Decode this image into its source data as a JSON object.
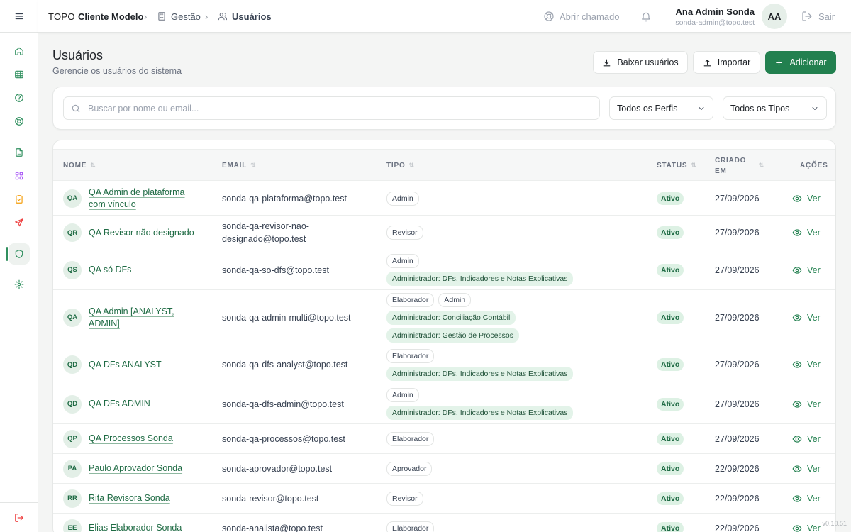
{
  "header": {
    "brand": "TOPO",
    "client": "Cliente Modelo",
    "crumb_1": "Gestão",
    "crumb_2": "Usuários",
    "ticket_label": "Abrir chamado",
    "user_name": "Ana Admin Sonda",
    "user_email": "sonda-admin@topo.test",
    "user_initials": "AA",
    "logout_label": "Sair"
  },
  "page": {
    "title": "Usuários",
    "subtitle": "Gerencie os usuários do sistema",
    "download_label": "Baixar usuários",
    "import_label": "Importar",
    "add_label": "Adicionar"
  },
  "filters": {
    "search_placeholder": "Buscar por nome ou email...",
    "profile_select": "Todos os Perfis",
    "type_select": "Todos os Tipos"
  },
  "table": {
    "columns": {
      "name": "NOME",
      "email": "EMAIL",
      "type": "TIPO",
      "status": "STATUS",
      "created_1": "CRIADO",
      "created_2": "EM",
      "actions": "AÇÕES"
    },
    "view_label": "Ver",
    "rows": [
      {
        "initials": "QA",
        "name": "QA Admin de plataforma com vínculo",
        "email": "sonda-qa-plataforma@topo.test",
        "types": [
          [
            "Admin"
          ]
        ],
        "status": "Ativo",
        "created": "27/09/2026"
      },
      {
        "initials": "QR",
        "name": "QA Revisor não designado",
        "email": "sonda-qa-revisor-nao-designado@topo.test",
        "types": [
          [
            "Revisor"
          ]
        ],
        "status": "Ativo",
        "created": "27/09/2026"
      },
      {
        "initials": "QS",
        "name": "QA só DFs",
        "email": "sonda-qa-so-dfs@topo.test",
        "types": [
          [
            "Admin"
          ],
          [
            "Administrador: DFs, Indicadores e Notas Explicativas"
          ]
        ],
        "status": "Ativo",
        "created": "27/09/2026"
      },
      {
        "initials": "QA",
        "name": "QA Admin [ANALYST, ADMIN]",
        "email": "sonda-qa-admin-multi@topo.test",
        "types": [
          [
            "Elaborador",
            "Admin"
          ],
          [
            "Administrador: Conciliação Contábil"
          ],
          [
            "Administrador: Gestão de Processos"
          ]
        ],
        "status": "Ativo",
        "created": "27/09/2026"
      },
      {
        "initials": "QD",
        "name": "QA DFs ANALYST",
        "email": "sonda-qa-dfs-analyst@topo.test",
        "types": [
          [
            "Elaborador"
          ],
          [
            "Administrador: DFs, Indicadores e Notas Explicativas"
          ]
        ],
        "status": "Ativo",
        "created": "27/09/2026"
      },
      {
        "initials": "QD",
        "name": "QA DFs ADMIN",
        "email": "sonda-qa-dfs-admin@topo.test",
        "types": [
          [
            "Admin"
          ],
          [
            "Administrador: DFs, Indicadores e Notas Explicativas"
          ]
        ],
        "status": "Ativo",
        "created": "27/09/2026"
      },
      {
        "initials": "QP",
        "name": "QA Processos Sonda",
        "email": "sonda-qa-processos@topo.test",
        "types": [
          [
            "Elaborador"
          ]
        ],
        "status": "Ativo",
        "created": "27/09/2026"
      },
      {
        "initials": "PA",
        "name": "Paulo Aprovador Sonda",
        "email": "sonda-aprovador@topo.test",
        "types": [
          [
            "Aprovador"
          ]
        ],
        "status": "Ativo",
        "created": "22/09/2026"
      },
      {
        "initials": "RR",
        "name": "Rita Revisora Sonda",
        "email": "sonda-revisor@topo.test",
        "types": [
          [
            "Revisor"
          ]
        ],
        "status": "Ativo",
        "created": "22/09/2026"
      },
      {
        "initials": "EE",
        "name": "Elias Elaborador Sonda",
        "email": "sonda-analista@topo.test",
        "types": [
          [
            "Elaborador"
          ]
        ],
        "status": "Ativo",
        "created": "22/09/2026"
      }
    ]
  },
  "version": "v0.10.51",
  "colors": {
    "accent": "#22804f",
    "status_bg": "#ddf1e4",
    "chip_green": "#e3f3e9"
  }
}
